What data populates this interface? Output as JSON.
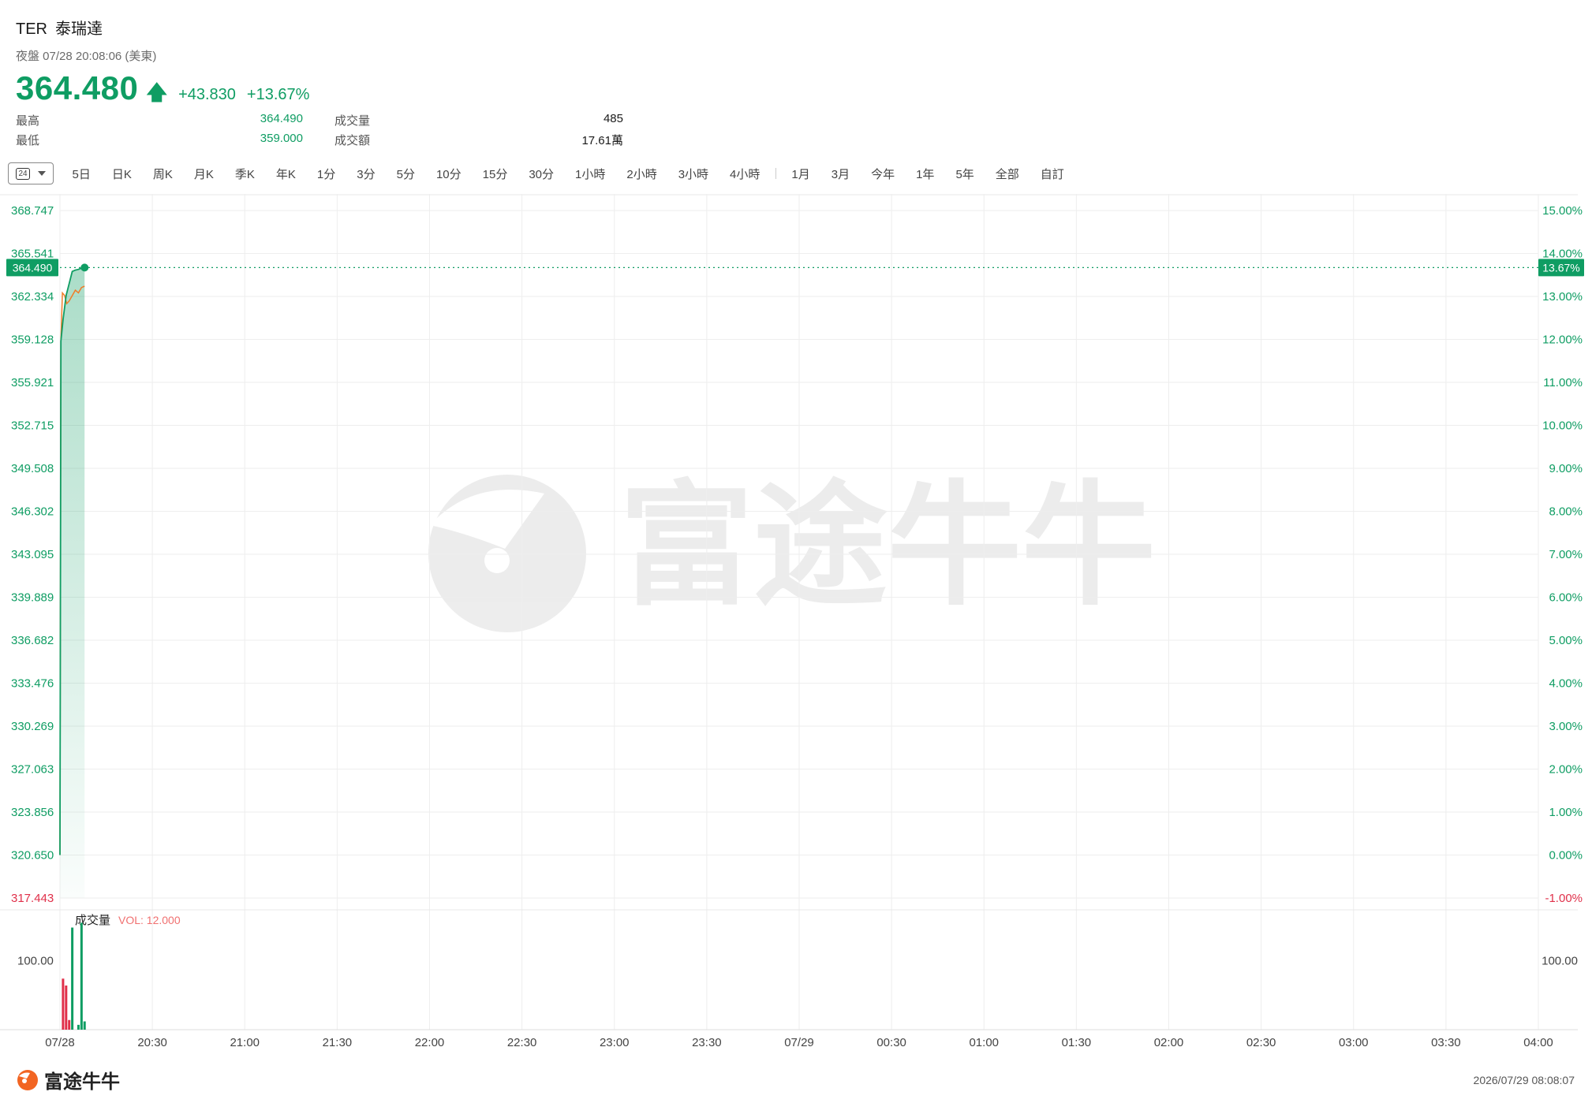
{
  "header": {
    "ticker": "TER",
    "name": "泰瑞達",
    "session": "夜盤 07/28 20:08:06 (美東)",
    "price": "364.480",
    "change": "+43.830",
    "change_pct": "+13.67%"
  },
  "stats": {
    "high_label": "最高",
    "high_value": "364.490",
    "low_label": "最低",
    "low_value": "359.000",
    "volume_label": "成交量",
    "volume_value": "485",
    "turnover_label": "成交額",
    "turnover_value": "17.61萬"
  },
  "toolbar": {
    "range_badge": "24",
    "items_a": [
      "5日",
      "日K",
      "周K",
      "月K",
      "季K",
      "年K",
      "1分",
      "3分",
      "5分",
      "10分",
      "15分",
      "30分",
      "1小時",
      "2小時",
      "3小時",
      "4小時"
    ],
    "items_b": [
      "1月",
      "3月",
      "今年",
      "1年",
      "5年",
      "全部",
      "自訂"
    ]
  },
  "colors": {
    "up": "#0f9d63",
    "down": "#e0304a",
    "avg_line": "#f07c28",
    "grid": "#eeeeee"
  },
  "chart_data": {
    "type": "line",
    "price_axis_ticks": [
      "368.747",
      "365.541",
      "362.334",
      "359.128",
      "355.921",
      "352.715",
      "349.508",
      "346.302",
      "343.095",
      "339.889",
      "336.682",
      "333.476",
      "330.269",
      "327.063",
      "323.856",
      "320.650",
      "317.443"
    ],
    "pct_axis_ticks": [
      "15.00%",
      "14.00%",
      "13.00%",
      "12.00%",
      "11.00%",
      "10.00%",
      "9.00%",
      "8.00%",
      "7.00%",
      "6.00%",
      "5.00%",
      "4.00%",
      "3.00%",
      "2.00%",
      "1.00%",
      "0.00%",
      "-1.00%"
    ],
    "ylim": [
      317.443,
      368.747
    ],
    "prev_close": 320.65,
    "current_label": "364.490",
    "current_pct_label": "13.67%",
    "x_ticks": [
      "07/28",
      "20:30",
      "21:00",
      "21:30",
      "22:00",
      "22:30",
      "23:00",
      "23:30",
      "07/29",
      "00:30",
      "01:00",
      "01:30",
      "02:00",
      "02:30",
      "03:00",
      "03:30",
      "04:00"
    ],
    "xlim_minutes": [
      0,
      480
    ],
    "price_series": {
      "x": [
        0,
        0.3,
        1,
        2,
        3,
        4,
        5,
        6,
        7,
        8
      ],
      "y": [
        320.65,
        359.0,
        360.6,
        362.4,
        363.3,
        364.2,
        364.3,
        364.35,
        364.45,
        364.49
      ]
    },
    "avg_series": {
      "x": [
        0,
        0.3,
        0.8,
        1.5,
        2.2,
        3,
        4,
        5,
        6,
        7,
        8
      ],
      "y": [
        320.65,
        359.0,
        362.6,
        362.4,
        361.8,
        362.0,
        362.4,
        362.8,
        362.6,
        363.0,
        363.1
      ]
    },
    "volume": {
      "label": "成交量",
      "vol_label": "VOL: 12.000",
      "axis_tick": "100.00",
      "ymax": 160,
      "bars": [
        {
          "x": 1,
          "v": 74,
          "dir": "down"
        },
        {
          "x": 2,
          "v": 64,
          "dir": "down"
        },
        {
          "x": 3,
          "v": 14,
          "dir": "down"
        },
        {
          "x": 4,
          "v": 148,
          "dir": "up"
        },
        {
          "x": 6,
          "v": 7,
          "dir": "up"
        },
        {
          "x": 7,
          "v": 155,
          "dir": "up"
        },
        {
          "x": 8,
          "v": 12,
          "dir": "up"
        }
      ]
    }
  },
  "footer": {
    "brand": "富途牛牛",
    "timestamp": "2026/07/29 08:08:07",
    "watermark": "富途牛牛"
  }
}
